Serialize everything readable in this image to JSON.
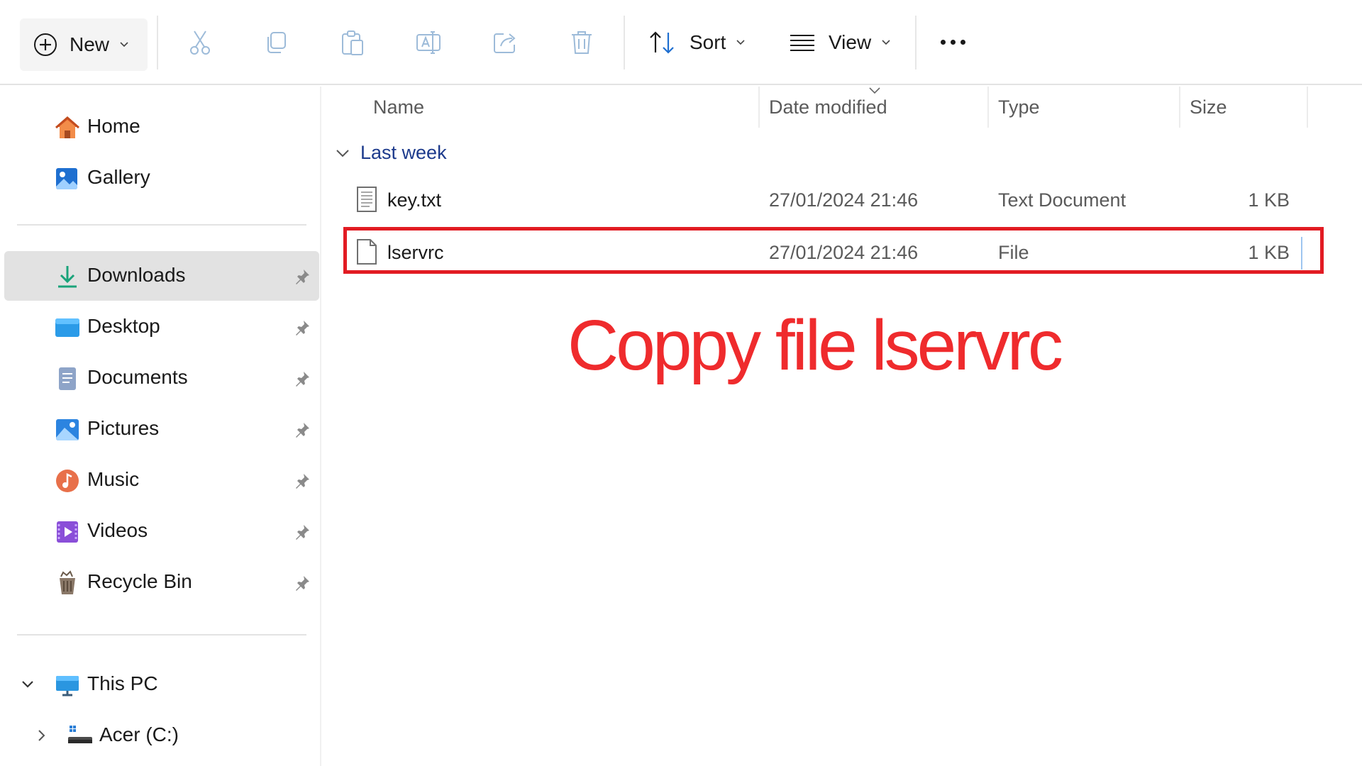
{
  "toolbar": {
    "new_label": "New",
    "sort_label": "Sort",
    "view_label": "View",
    "icons": [
      "plus-circle-icon",
      "cut-icon",
      "copy-icon",
      "paste-icon",
      "rename-icon",
      "share-icon",
      "delete-icon",
      "sort-icon",
      "view-icon",
      "more-icon"
    ]
  },
  "nav": {
    "quick": [
      {
        "label": "Home",
        "icon": "home-icon"
      },
      {
        "label": "Gallery",
        "icon": "gallery-icon"
      }
    ],
    "pinned": [
      {
        "label": "Downloads",
        "icon": "downloads-icon",
        "selected": true
      },
      {
        "label": "Desktop",
        "icon": "desktop-icon"
      },
      {
        "label": "Documents",
        "icon": "documents-icon"
      },
      {
        "label": "Pictures",
        "icon": "pictures-icon"
      },
      {
        "label": "Music",
        "icon": "music-icon"
      },
      {
        "label": "Videos",
        "icon": "videos-icon"
      },
      {
        "label": "Recycle Bin",
        "icon": "recycle-bin-icon"
      }
    ],
    "this_pc": "This PC",
    "drive": "Acer (C:)"
  },
  "columns": {
    "name": "Name",
    "date": "Date modified",
    "type": "Type",
    "size": "Size"
  },
  "group_label": "Last week",
  "files": [
    {
      "name": "key.txt",
      "date": "27/01/2024 21:46",
      "type": "Text Document",
      "size": "1 KB",
      "icon": "text-file-icon"
    },
    {
      "name": "lservrc",
      "date": "27/01/2024 21:46",
      "type": "File",
      "size": "1 KB",
      "icon": "file-icon",
      "highlighted": true
    }
  ],
  "annotation": "Coppy file lservrc",
  "colors": {
    "highlight": "#e21b23",
    "annotation": "#ef2b2d",
    "group": "#1c3a8c",
    "selected": "#e2e2e2"
  }
}
